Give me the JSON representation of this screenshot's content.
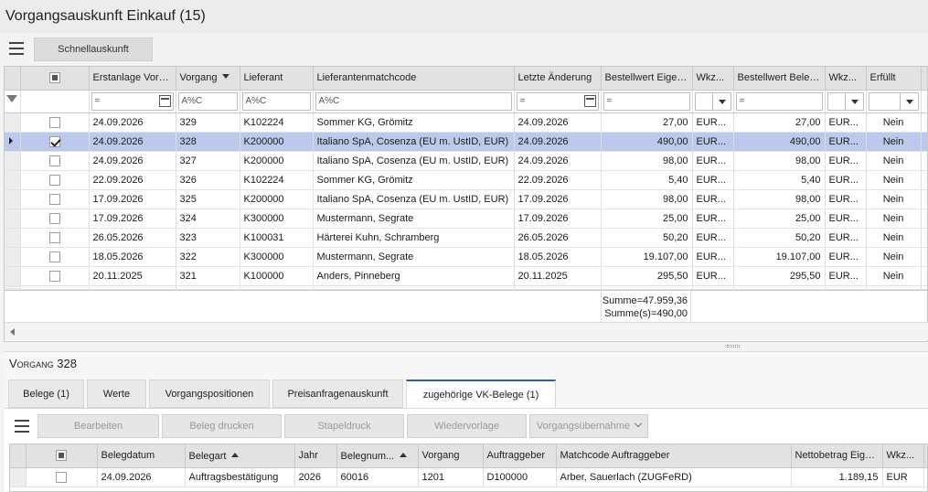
{
  "window": {
    "title": "Vorgangsauskunft Einkauf (15)"
  },
  "toolbar": {
    "quick_info": "Schnellauskunft"
  },
  "main_grid": {
    "columns": [
      "Erstanlage Vorg...",
      "Vorgang",
      "Lieferant",
      "Lieferantenmatchcode",
      "Letzte Änderung",
      "Bestellwert Eigen...",
      "Wkz...",
      "Bestellwert Beleg...",
      "Wkz...",
      "Erfüllt"
    ],
    "filter_ops": {
      "eq": "=",
      "like": "A%C"
    },
    "rows": [
      {
        "checked": false,
        "selected": false,
        "c": [
          "24.09.2026",
          "329",
          "K102224",
          "Sommer KG, Grömitz",
          "24.09.2026",
          "27,00",
          "EUR...",
          "27,00",
          "EUR...",
          "Nein"
        ]
      },
      {
        "checked": true,
        "selected": true,
        "c": [
          "24.09.2026",
          "328",
          "K200000",
          "Italiano SpA, Cosenza (EU m. UstID, EUR)",
          "24.09.2026",
          "490,00",
          "EUR...",
          "490,00",
          "EUR...",
          "Nein"
        ]
      },
      {
        "checked": false,
        "selected": false,
        "c": [
          "24.09.2026",
          "327",
          "K200000",
          "Italiano SpA, Cosenza (EU m. UstID, EUR)",
          "24.09.2026",
          "98,00",
          "EUR...",
          "98,00",
          "EUR...",
          "Nein"
        ]
      },
      {
        "checked": false,
        "selected": false,
        "c": [
          "22.09.2026",
          "326",
          "K102224",
          "Sommer KG, Grömitz",
          "22.09.2026",
          "5,40",
          "EUR...",
          "5,40",
          "EUR...",
          "Nein"
        ]
      },
      {
        "checked": false,
        "selected": false,
        "c": [
          "17.09.2026",
          "325",
          "K200000",
          "Italiano SpA, Cosenza (EU m. UstID, EUR)",
          "17.09.2026",
          "98,00",
          "EUR...",
          "98,00",
          "EUR...",
          "Nein"
        ]
      },
      {
        "checked": false,
        "selected": false,
        "c": [
          "17.09.2026",
          "324",
          "K300000",
          "Mustermann, Segrate",
          "17.09.2026",
          "25,00",
          "EUR...",
          "25,00",
          "EUR...",
          "Nein"
        ]
      },
      {
        "checked": false,
        "selected": false,
        "c": [
          "26.05.2026",
          "323",
          "K100031",
          "Härterei Kuhn, Schramberg",
          "26.05.2026",
          "50,20",
          "EUR...",
          "50,20",
          "EUR...",
          "Nein"
        ]
      },
      {
        "checked": false,
        "selected": false,
        "c": [
          "18.05.2026",
          "322",
          "K300000",
          "Mustermann, Segrate",
          "18.05.2026",
          "19.107,00",
          "EUR...",
          "19.107,00",
          "EUR...",
          "Nein"
        ]
      },
      {
        "checked": false,
        "selected": false,
        "c": [
          "20.11.2025",
          "321",
          "K100000",
          "Anders, Pinneberg",
          "20.11.2025",
          "295,50",
          "EUR...",
          "295,50",
          "EUR...",
          "Nein"
        ]
      }
    ],
    "summary": {
      "total": "Summe=47.959,36",
      "selected": "Summe(s)=490,00"
    }
  },
  "detail": {
    "title": "Vorgang 328",
    "tabs": [
      "Belege (1)",
      "Werte",
      "Vorgangspositionen",
      "Preisanfragenauskunft",
      "zugehörige VK-Belege (1)"
    ],
    "buttons": {
      "edit": "Bearbeiten",
      "print": "Beleg drucken",
      "batch_print": "Stapeldruck",
      "resubmit": "Wiedervorlage",
      "takeover": "Vorgangsübernahme"
    },
    "columns": [
      "Belegdatum",
      "Belegart",
      "Jahr",
      "Belegnum...",
      "Vorgang",
      "Auftraggeber",
      "Matchcode Auftraggeber",
      "Nettobetrag Eige...",
      "Wkz..."
    ],
    "rows": [
      {
        "checked": false,
        "c": [
          "24.09.2026",
          "Auftragsbestätigung",
          "2026",
          "60016",
          "1201",
          "D100000",
          "Arber, Sauerlach (ZUGFeRD)",
          "1.189,15",
          "EUR"
        ]
      }
    ]
  }
}
